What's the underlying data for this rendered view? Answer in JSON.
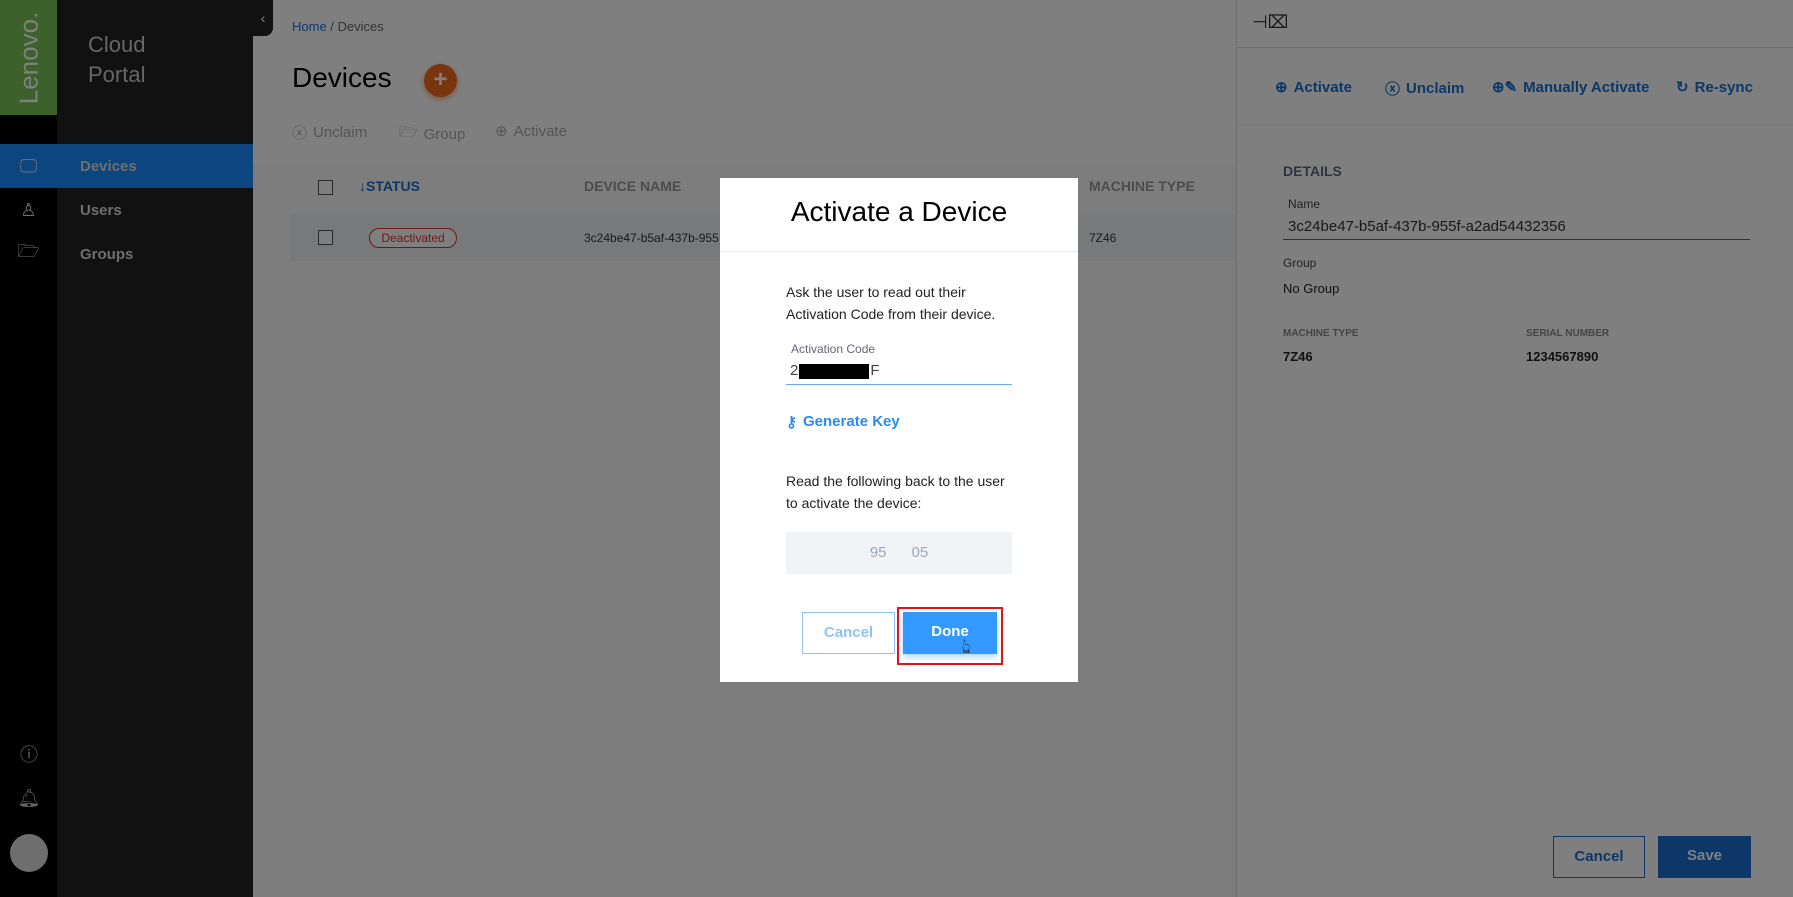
{
  "sidebar": {
    "logo": "Lenovo.",
    "brand_line1": "Cloud",
    "brand_line2": "Portal",
    "items": [
      {
        "label": "Devices",
        "icon": "monitor-icon",
        "active": true
      },
      {
        "label": "Users",
        "icon": "user-icon"
      },
      {
        "label": "Groups",
        "icon": "folder-icon"
      }
    ],
    "bottom_icons": [
      "info-icon",
      "bell-icon",
      "avatar"
    ]
  },
  "breadcrumb": {
    "home": "Home",
    "sep": " / ",
    "current": "Devices"
  },
  "page": {
    "title": "Devices",
    "add_icon": "plus-icon"
  },
  "toolbar": {
    "unclaim": "Unclaim",
    "group": "Group",
    "activate": "Activate"
  },
  "table": {
    "columns": [
      "STATUS",
      "DEVICE NAME",
      "MACHINE TYPE"
    ],
    "sort_arrow": "↓",
    "rows": [
      {
        "status": "Deactivated",
        "device_name": "3c24be47-b5af-437b-955",
        "machine_type": "7Z46"
      }
    ]
  },
  "panel": {
    "actions": {
      "activate": "Activate",
      "unclaim": "Unclaim",
      "manual": "Manually Activate",
      "resync": "Re-sync"
    },
    "section": "DETAILS",
    "name_label": "Name",
    "name_value": "3c24be47-b5af-437b-955f-a2ad54432356",
    "group_label": "Group",
    "group_value": "No Group",
    "machine_type_label": "MACHINE TYPE",
    "machine_type_value": "7Z46",
    "serial_label": "SERIAL NUMBER",
    "serial_value": "1234567890",
    "cancel": "Cancel",
    "save": "Save"
  },
  "modal": {
    "title": "Activate a Device",
    "instruction1": "Ask the user to read out their",
    "instruction2": "Activation Code from their device.",
    "code_label": "Activation Code",
    "code_prefix": "2",
    "code_suffix": "F",
    "generate_key": "Generate Key",
    "readback1": "Read the following back to the user",
    "readback2": "to activate the device:",
    "key_value": "95      05",
    "cancel": "Cancel",
    "done": "Done"
  },
  "colors": {
    "accent": "#1a8cff",
    "brand_green": "#78c256",
    "add_button": "#f26b1b",
    "status_deactivated": "#dd3333",
    "highlight": "#e3131b"
  }
}
